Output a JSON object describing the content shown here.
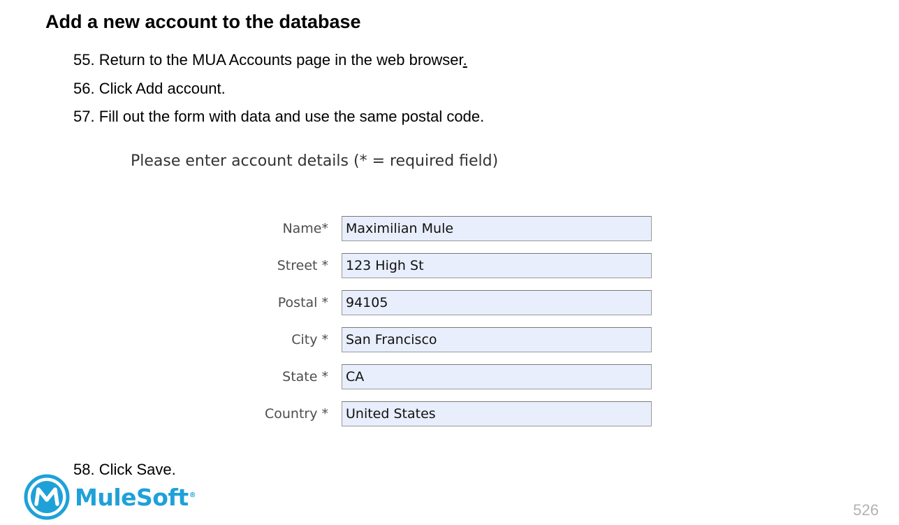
{
  "document": {
    "heading": "Add a new account to the database",
    "steps": {
      "s55": {
        "text": "55. Return to the MUA Accounts page in the web browser",
        "trailing": "."
      },
      "s56": {
        "text": "56. Click Add account."
      },
      "s57": {
        "text": "57. Fill out the form with data and use the same postal code."
      },
      "s58": {
        "text": "58. Click Save."
      }
    },
    "page_number": "526"
  },
  "form": {
    "caption": "Please enter account details (* = required field)",
    "fields": [
      {
        "label": "Name*",
        "value": "Maximilian Mule"
      },
      {
        "label": "Street *",
        "value": "123 High St"
      },
      {
        "label": "Postal *",
        "value": "94105"
      },
      {
        "label": "City *",
        "value": "San Francisco"
      },
      {
        "label": "State *",
        "value": "CA"
      },
      {
        "label": "Country *",
        "value": "United States"
      }
    ]
  },
  "logo": {
    "name": "MuleSoft",
    "trademark": "®",
    "icon": "mulesoft-logo-icon",
    "color": "#1ea1d8"
  },
  "colors": {
    "input_background": "#e8eefb",
    "page_number": "#b3b3b3"
  }
}
